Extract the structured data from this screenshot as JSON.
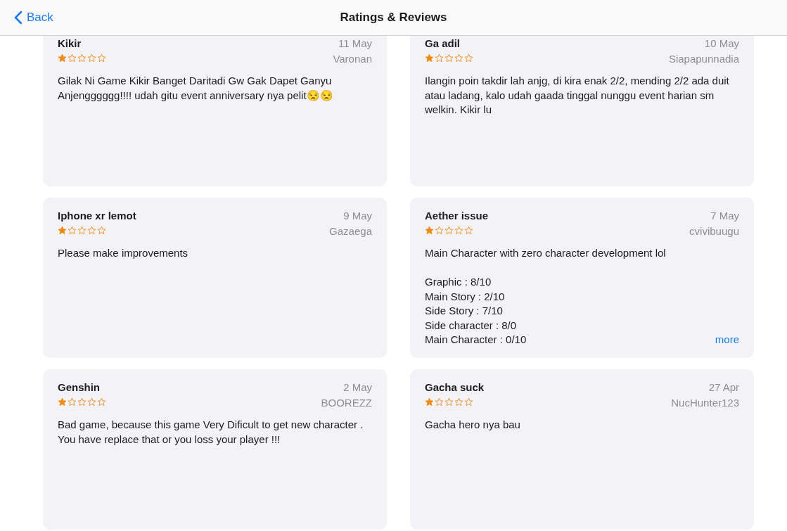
{
  "nav": {
    "back": "Back",
    "title": "Ratings & Reviews"
  },
  "reviews": [
    {
      "title": "Kikir",
      "date": "11 May",
      "author": "Varonan",
      "stars": 1,
      "body": "Gilak Ni Game Kikir Banget Daritadi Gw Gak Dapet Ganyu Anjengggggg!!!! udah gitu event anniversary nya pelit😒😒"
    },
    {
      "title": "Ga adil",
      "date": "10 May",
      "author": "Siapapunnadia",
      "stars": 1,
      "body": "Ilangin poin takdir lah anjg, di kira enak 2/2, mending 2/2 ada duit atau ladang, kalo udah gaada tinggal nunggu event harian sm welkin. Kikir lu"
    },
    {
      "title": "Iphone xr lemot",
      "date": "9 May",
      "author": "Gazaega",
      "stars": 1,
      "body": "Please make improvements"
    },
    {
      "title": "Aether issue",
      "date": "7 May",
      "author": "cvivibuugu",
      "stars": 1,
      "body": "Main Character with zero character development lol\n\nGraphic : 8/10\nMain Story : 2/10\nSide Story : 7/10\nSide character : 8/0\nMain Character : 0/10",
      "more": "more"
    },
    {
      "title": "Genshin",
      "date": "2 May",
      "author": "BOOREZZ",
      "stars": 1,
      "body": "Bad game, because this game Very Dificult to get new character . You have replace that or you loss your player !!!"
    },
    {
      "title": "Gacha suck",
      "date": "27 Apr",
      "author": "NucHunter123",
      "stars": 1,
      "body": "Gacha hero nya bau"
    }
  ]
}
